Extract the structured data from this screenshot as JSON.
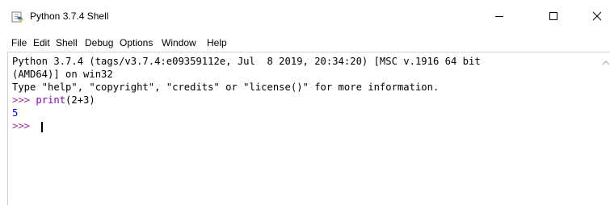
{
  "window": {
    "title": "Python 3.7.4 Shell"
  },
  "menu": [
    "File",
    "Edit",
    "Shell",
    "Debug",
    "Options",
    "Window",
    "Help"
  ],
  "shell": {
    "banner_line1": "Python 3.7.4 (tags/v3.7.4:e09359112e, Jul  8 2019, 20:34:20) [MSC v.1916 64 bit",
    "banner_line2": "(AMD64)] on win32",
    "banner_line3": "Type \"help\", \"copyright\", \"credits\" or \"license()\" for more information.",
    "prompt": ">>> ",
    "command_keyword": "print",
    "command_args": "(2+3)",
    "output": "5",
    "prompt_current": ">>> "
  },
  "colors": {
    "prompt": "#a0279c",
    "keyword": "#8a00c8",
    "output": "#0000ff"
  },
  "icons": {
    "app": "python-idle-icon",
    "minimize": "minimize-icon",
    "maximize": "maximize-icon",
    "close": "close-icon"
  }
}
